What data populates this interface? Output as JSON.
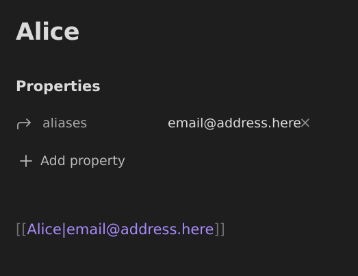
{
  "note": {
    "title": "Alice"
  },
  "properties": {
    "heading": "Properties",
    "items": [
      {
        "icon": "arrow-corner-up-right-icon",
        "key": "aliases",
        "value": "email@address.here",
        "remove_glyph": "×"
      }
    ],
    "add_label": "Add property",
    "add_icon": "plus-icon"
  },
  "body": {
    "open_brackets": "[[",
    "link_target": "Alice",
    "pipe": "|",
    "link_alias": "email@address.here",
    "close_brackets": "]]"
  },
  "colors": {
    "background": "#1e1e1e",
    "text": "#dadada",
    "muted": "#a8a8a8",
    "link": "#a78bfa",
    "bracket": "#6f6f6f"
  }
}
